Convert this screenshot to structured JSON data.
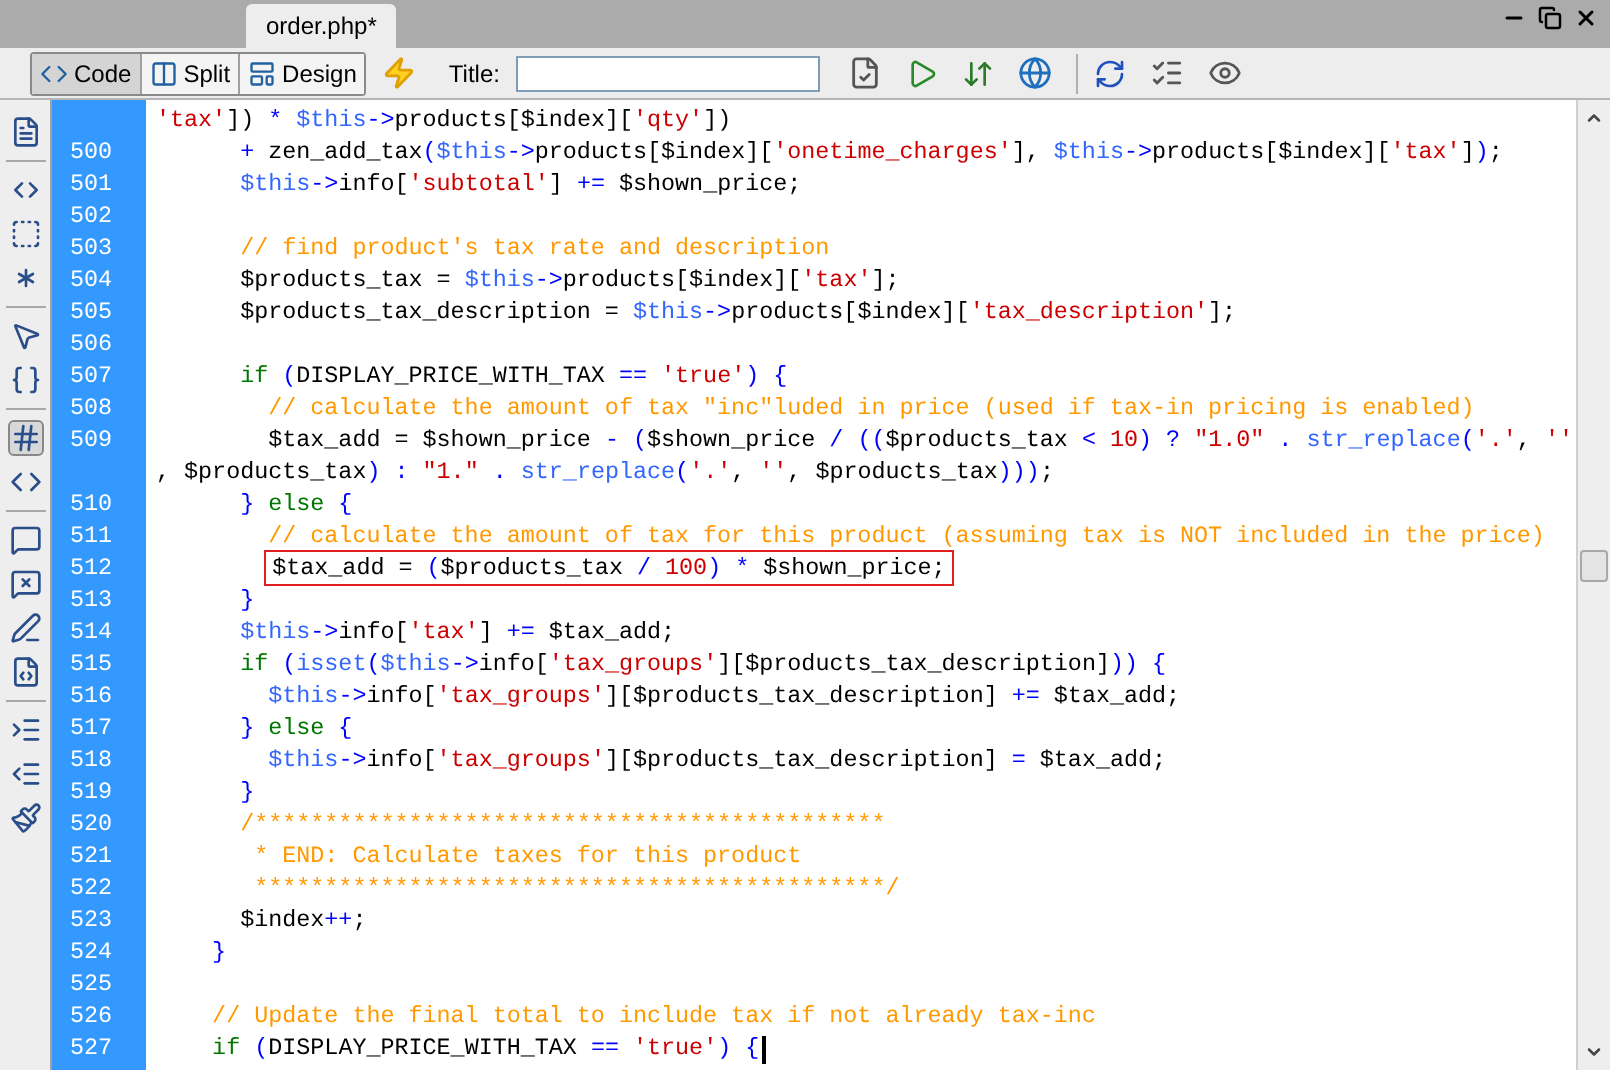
{
  "document_tab": {
    "title": "order.php*",
    "selected": true
  },
  "views": [
    {
      "label": "Code",
      "selected": true
    },
    {
      "label": "Split",
      "selected": false
    },
    {
      "label": "Design",
      "selected": false
    }
  ],
  "title_field": {
    "label": "Title:"
  },
  "lines": [
    {
      "segments": [
        {
          "kind": "str",
          "text": "'tax'"
        },
        {
          "kind": "code",
          "text": "]) "
        },
        {
          "kind": "op",
          "text": "* "
        },
        {
          "kind": "var",
          "text": "$this"
        },
        {
          "kind": "op",
          "text": "->"
        },
        {
          "kind": "code",
          "text": "products[$index]["
        },
        {
          "kind": "str",
          "text": "'qty'"
        },
        {
          "kind": "code",
          "text": "])"
        }
      ]
    },
    {
      "number": "500",
      "segments": [
        {
          "kind": "op",
          "text": "      + "
        },
        {
          "kind": "code",
          "text": "zen_add_tax"
        },
        {
          "kind": "op",
          "text": "("
        },
        {
          "kind": "var",
          "text": "$this"
        },
        {
          "kind": "op",
          "text": "->"
        },
        {
          "kind": "code",
          "text": "products[$index]["
        },
        {
          "kind": "str",
          "text": "'onetime_charges'"
        },
        {
          "kind": "code",
          "text": "], "
        },
        {
          "kind": "var",
          "text": "$this"
        },
        {
          "kind": "op",
          "text": "->"
        },
        {
          "kind": "code",
          "text": "products[$index]["
        },
        {
          "kind": "str",
          "text": "'tax'"
        },
        {
          "kind": "code",
          "text": "]"
        },
        {
          "kind": "op",
          "text": ")"
        },
        {
          "kind": "code",
          "text": ";"
        }
      ]
    },
    {
      "number": "501",
      "segments": [
        {
          "kind": "var",
          "text": "      $this"
        },
        {
          "kind": "op",
          "text": "->"
        },
        {
          "kind": "code",
          "text": "info["
        },
        {
          "kind": "str",
          "text": "'subtotal'"
        },
        {
          "kind": "code",
          "text": "] "
        },
        {
          "kind": "op",
          "text": "+="
        },
        {
          "kind": "code",
          "text": " $shown_price;"
        }
      ]
    },
    {
      "number": "502"
    },
    {
      "number": "503",
      "segments": [
        {
          "kind": "cmt",
          "text": "      // find product's tax rate and description"
        }
      ]
    },
    {
      "number": "504",
      "segments": [
        {
          "kind": "code",
          "text": "      $products_tax = "
        },
        {
          "kind": "var",
          "text": "$this"
        },
        {
          "kind": "op",
          "text": "->"
        },
        {
          "kind": "code",
          "text": "products[$index]["
        },
        {
          "kind": "str",
          "text": "'tax'"
        },
        {
          "kind": "code",
          "text": "];"
        }
      ]
    },
    {
      "number": "505",
      "segments": [
        {
          "kind": "code",
          "text": "      $products_tax_description = "
        },
        {
          "kind": "var",
          "text": "$this"
        },
        {
          "kind": "op",
          "text": "->"
        },
        {
          "kind": "code",
          "text": "products[$index]["
        },
        {
          "kind": "str",
          "text": "'tax_description'"
        },
        {
          "kind": "code",
          "text": "];"
        }
      ]
    },
    {
      "number": "506"
    },
    {
      "number": "507",
      "segments": [
        {
          "kind": "kw",
          "text": "      if "
        },
        {
          "kind": "op",
          "text": "("
        },
        {
          "kind": "code",
          "text": "DISPLAY_PRICE_WITH_TAX "
        },
        {
          "kind": "op",
          "text": "== "
        },
        {
          "kind": "str",
          "text": "'true'"
        },
        {
          "kind": "op",
          "text": ") {"
        }
      ]
    },
    {
      "number": "508",
      "segments": [
        {
          "kind": "cmt",
          "text": "        // calculate the amount of tax \"inc\"luded in price (used if tax-in pricing is enabled)"
        }
      ]
    },
    {
      "number": "509",
      "segments": [
        {
          "kind": "code",
          "text": "        $tax_add = $shown_price "
        },
        {
          "kind": "op",
          "text": "- ("
        },
        {
          "kind": "code",
          "text": "$shown_price "
        },
        {
          "kind": "op",
          "text": "/ (("
        },
        {
          "kind": "code",
          "text": "$products_tax "
        },
        {
          "kind": "op",
          "text": "< "
        },
        {
          "kind": "str",
          "text": "10"
        },
        {
          "kind": "op",
          "text": ") ? "
        },
        {
          "kind": "str",
          "text": "\"1.0\""
        },
        {
          "kind": "op",
          "text": " . "
        },
        {
          "kind": "fn",
          "text": "str_replace"
        },
        {
          "kind": "op",
          "text": "("
        },
        {
          "kind": "str",
          "text": "'.'"
        },
        {
          "kind": "code",
          "text": ", "
        },
        {
          "kind": "str",
          "text": "''"
        }
      ]
    },
    {
      "segments": [
        {
          "kind": "code",
          "text": ", $products_tax"
        },
        {
          "kind": "op",
          "text": ") : "
        },
        {
          "kind": "str",
          "text": "\"1.\""
        },
        {
          "kind": "op",
          "text": " . "
        },
        {
          "kind": "fn",
          "text": "str_replace"
        },
        {
          "kind": "op",
          "text": "("
        },
        {
          "kind": "str",
          "text": "'.'"
        },
        {
          "kind": "code",
          "text": ", "
        },
        {
          "kind": "str",
          "text": "''"
        },
        {
          "kind": "code",
          "text": ", $products_tax"
        },
        {
          "kind": "op",
          "text": ")))"
        },
        {
          "kind": "code",
          "text": ";"
        }
      ]
    },
    {
      "number": "510",
      "segments": [
        {
          "kind": "op",
          "text": "      } "
        },
        {
          "kind": "kw",
          "text": "else"
        },
        {
          "kind": "op",
          "text": " {"
        }
      ]
    },
    {
      "number": "511",
      "segments": [
        {
          "kind": "cmt",
          "text": "        // calculate the amount of tax for this product (assuming tax is NOT included in the price)"
        }
      ]
    },
    {
      "number": "512",
      "highlighted": true,
      "segments": [
        {
          "kind": "code",
          "text": "        $tax_add = "
        },
        {
          "kind": "op",
          "text": "("
        },
        {
          "kind": "code",
          "text": "$products_tax "
        },
        {
          "kind": "op",
          "text": "/ "
        },
        {
          "kind": "str",
          "text": "100"
        },
        {
          "kind": "op",
          "text": ") * "
        },
        {
          "kind": "code",
          "text": "$shown_price;"
        }
      ]
    },
    {
      "number": "513",
      "segments": [
        {
          "kind": "op",
          "text": "      }"
        }
      ]
    },
    {
      "number": "514",
      "segments": [
        {
          "kind": "var",
          "text": "      $this"
        },
        {
          "kind": "op",
          "text": "->"
        },
        {
          "kind": "code",
          "text": "info["
        },
        {
          "kind": "str",
          "text": "'tax'"
        },
        {
          "kind": "code",
          "text": "] "
        },
        {
          "kind": "op",
          "text": "+="
        },
        {
          "kind": "code",
          "text": " $tax_add;"
        }
      ]
    },
    {
      "number": "515",
      "segments": [
        {
          "kind": "kw",
          "text": "      if "
        },
        {
          "kind": "op",
          "text": "("
        },
        {
          "kind": "fn",
          "text": "isset"
        },
        {
          "kind": "op",
          "text": "("
        },
        {
          "kind": "var",
          "text": "$this"
        },
        {
          "kind": "op",
          "text": "->"
        },
        {
          "kind": "code",
          "text": "info["
        },
        {
          "kind": "str",
          "text": "'tax_groups'"
        },
        {
          "kind": "code",
          "text": "][$products_tax_description]"
        },
        {
          "kind": "op",
          "text": ")) {"
        }
      ]
    },
    {
      "number": "516",
      "segments": [
        {
          "kind": "var",
          "text": "        $this"
        },
        {
          "kind": "op",
          "text": "->"
        },
        {
          "kind": "code",
          "text": "info["
        },
        {
          "kind": "str",
          "text": "'tax_groups'"
        },
        {
          "kind": "code",
          "text": "][$products_tax_description] "
        },
        {
          "kind": "op",
          "text": "+="
        },
        {
          "kind": "code",
          "text": " $tax_add;"
        }
      ]
    },
    {
      "number": "517",
      "segments": [
        {
          "kind": "op",
          "text": "      } "
        },
        {
          "kind": "kw",
          "text": "else"
        },
        {
          "kind": "op",
          "text": " {"
        }
      ]
    },
    {
      "number": "518",
      "segments": [
        {
          "kind": "var",
          "text": "        $this"
        },
        {
          "kind": "op",
          "text": "->"
        },
        {
          "kind": "code",
          "text": "info["
        },
        {
          "kind": "str",
          "text": "'tax_groups'"
        },
        {
          "kind": "code",
          "text": "][$products_tax_description] "
        },
        {
          "kind": "op",
          "text": "="
        },
        {
          "kind": "code",
          "text": " $tax_add;"
        }
      ]
    },
    {
      "number": "519",
      "segments": [
        {
          "kind": "op",
          "text": "      }"
        }
      ]
    },
    {
      "number": "520",
      "segments": [
        {
          "kind": "cmt",
          "text": "      /*********************************************"
        }
      ]
    },
    {
      "number": "521",
      "segments": [
        {
          "kind": "cmt",
          "text": "       * END: Calculate taxes for this product"
        }
      ]
    },
    {
      "number": "522",
      "segments": [
        {
          "kind": "cmt",
          "text": "       *********************************************/"
        }
      ]
    },
    {
      "number": "523",
      "segments": [
        {
          "kind": "code",
          "text": "      $index"
        },
        {
          "kind": "op",
          "text": "++"
        },
        {
          "kind": "code",
          "text": ";"
        }
      ]
    },
    {
      "number": "524",
      "segments": [
        {
          "kind": "op",
          "text": "    }"
        }
      ]
    },
    {
      "number": "525"
    },
    {
      "number": "526",
      "segments": [
        {
          "kind": "cmt",
          "text": "    // Update the final total to include tax if not already tax-inc"
        }
      ]
    },
    {
      "number": "527",
      "cursor": true,
      "segments": [
        {
          "kind": "kw",
          "text": "    if "
        },
        {
          "kind": "op",
          "text": "("
        },
        {
          "kind": "code",
          "text": "DISPLAY_PRICE_WITH_TAX "
        },
        {
          "kind": "op",
          "text": "== "
        },
        {
          "kind": "str",
          "text": "'true'"
        },
        {
          "kind": "op",
          "text": ") {"
        }
      ]
    }
  ]
}
